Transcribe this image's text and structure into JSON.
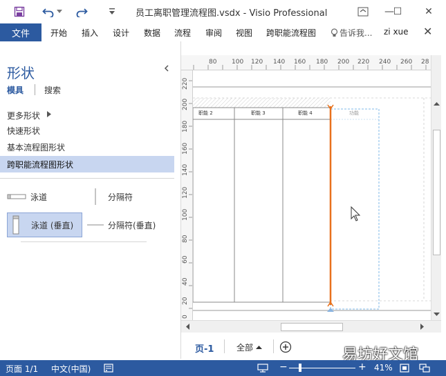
{
  "window": {
    "title": "员工离职管理流程图.vsdx - Visio Professional",
    "controls": {
      "minimize": "—",
      "restore": "☐",
      "close": "✕"
    }
  },
  "quick_access": {
    "save_icon": "save-icon",
    "undo_icon": "undo-icon",
    "redo_icon": "redo-icon",
    "customize_icon": "customize-qat-icon"
  },
  "ribbon": {
    "file_tab": "文件",
    "tabs": [
      "开始",
      "插入",
      "设计",
      "数据",
      "流程",
      "审阅",
      "视图",
      "跨职能流程图"
    ],
    "tell_me": "告诉我...",
    "user": "zi xue",
    "close": "✕"
  },
  "shapes_panel": {
    "title": "形状",
    "tabs": [
      "模具",
      "搜索"
    ],
    "more_shapes": "更多形状",
    "stencils": [
      "快速形状",
      "基本流程图形状",
      "跨职能流程图形状"
    ],
    "items": [
      {
        "label": "泳道"
      },
      {
        "label": "分隔符"
      },
      {
        "label": "泳道 (垂直)"
      },
      {
        "label": "分隔符(垂直)"
      }
    ]
  },
  "ruler": {
    "horizontal": [
      "80",
      "100",
      "120",
      "140",
      "160",
      "180",
      "200",
      "220",
      "240",
      "260",
      "28"
    ],
    "vertical": [
      "220",
      "200",
      "180",
      "160",
      "140",
      "120",
      "100",
      "80",
      "60",
      "40",
      "20",
      "0"
    ]
  },
  "diagram": {
    "lanes": [
      "职能 2",
      "职能 3",
      "职能 4",
      "功能"
    ],
    "separator_color": "#e8711c"
  },
  "page_tabs": {
    "current": "页-1",
    "all": "全部",
    "add_icon": "add-page-icon"
  },
  "status": {
    "page": "页面 1/1",
    "language": "中文(中国)",
    "zoom": "41%"
  },
  "watermark": "易坊好文馆",
  "colors": {
    "accent": "#2c5aa0",
    "selection": "#c8d6f0",
    "separator": "#e8711c"
  }
}
